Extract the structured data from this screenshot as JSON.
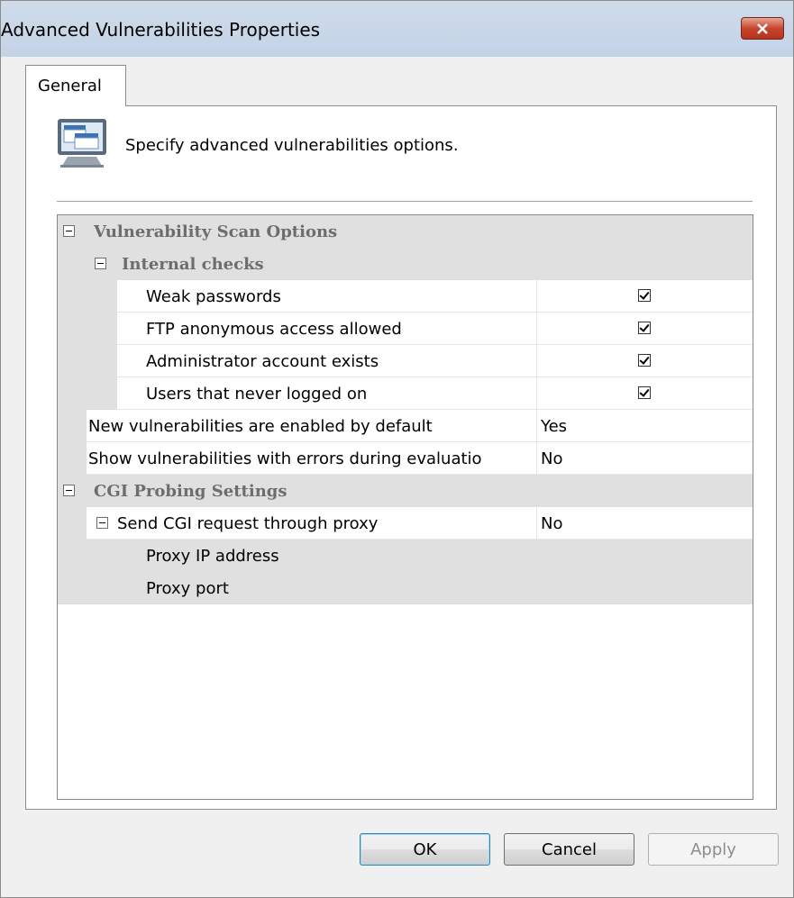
{
  "window": {
    "title": "Advanced Vulnerabilities Properties"
  },
  "tabs": [
    {
      "label": "General"
    }
  ],
  "header": {
    "description": "Specify advanced vulnerabilities options."
  },
  "grid": {
    "cat_scan": "Vulnerability Scan Options",
    "cat_internal": "Internal checks",
    "weak_passwords": {
      "label": "Weak passwords",
      "checked": true
    },
    "ftp_anonymous": {
      "label": "FTP anonymous access allowed",
      "checked": true
    },
    "admin_exists": {
      "label": "Administrator account exists",
      "checked": true
    },
    "never_logged": {
      "label": "Users that never logged on",
      "checked": true
    },
    "new_vulns": {
      "label": "New vulnerabilities are enabled by default",
      "value": "Yes"
    },
    "show_errors": {
      "label": "Show vulnerabilities with errors during evaluatio",
      "value": "No"
    },
    "cat_cgi": "CGI Probing Settings",
    "send_cgi": {
      "label": "Send CGI request through proxy",
      "value": "No"
    },
    "proxy_ip": {
      "label": "Proxy IP address",
      "value": ""
    },
    "proxy_port": {
      "label": "Proxy port",
      "value": ""
    }
  },
  "buttons": {
    "ok": "OK",
    "cancel": "Cancel",
    "apply": "Apply"
  }
}
